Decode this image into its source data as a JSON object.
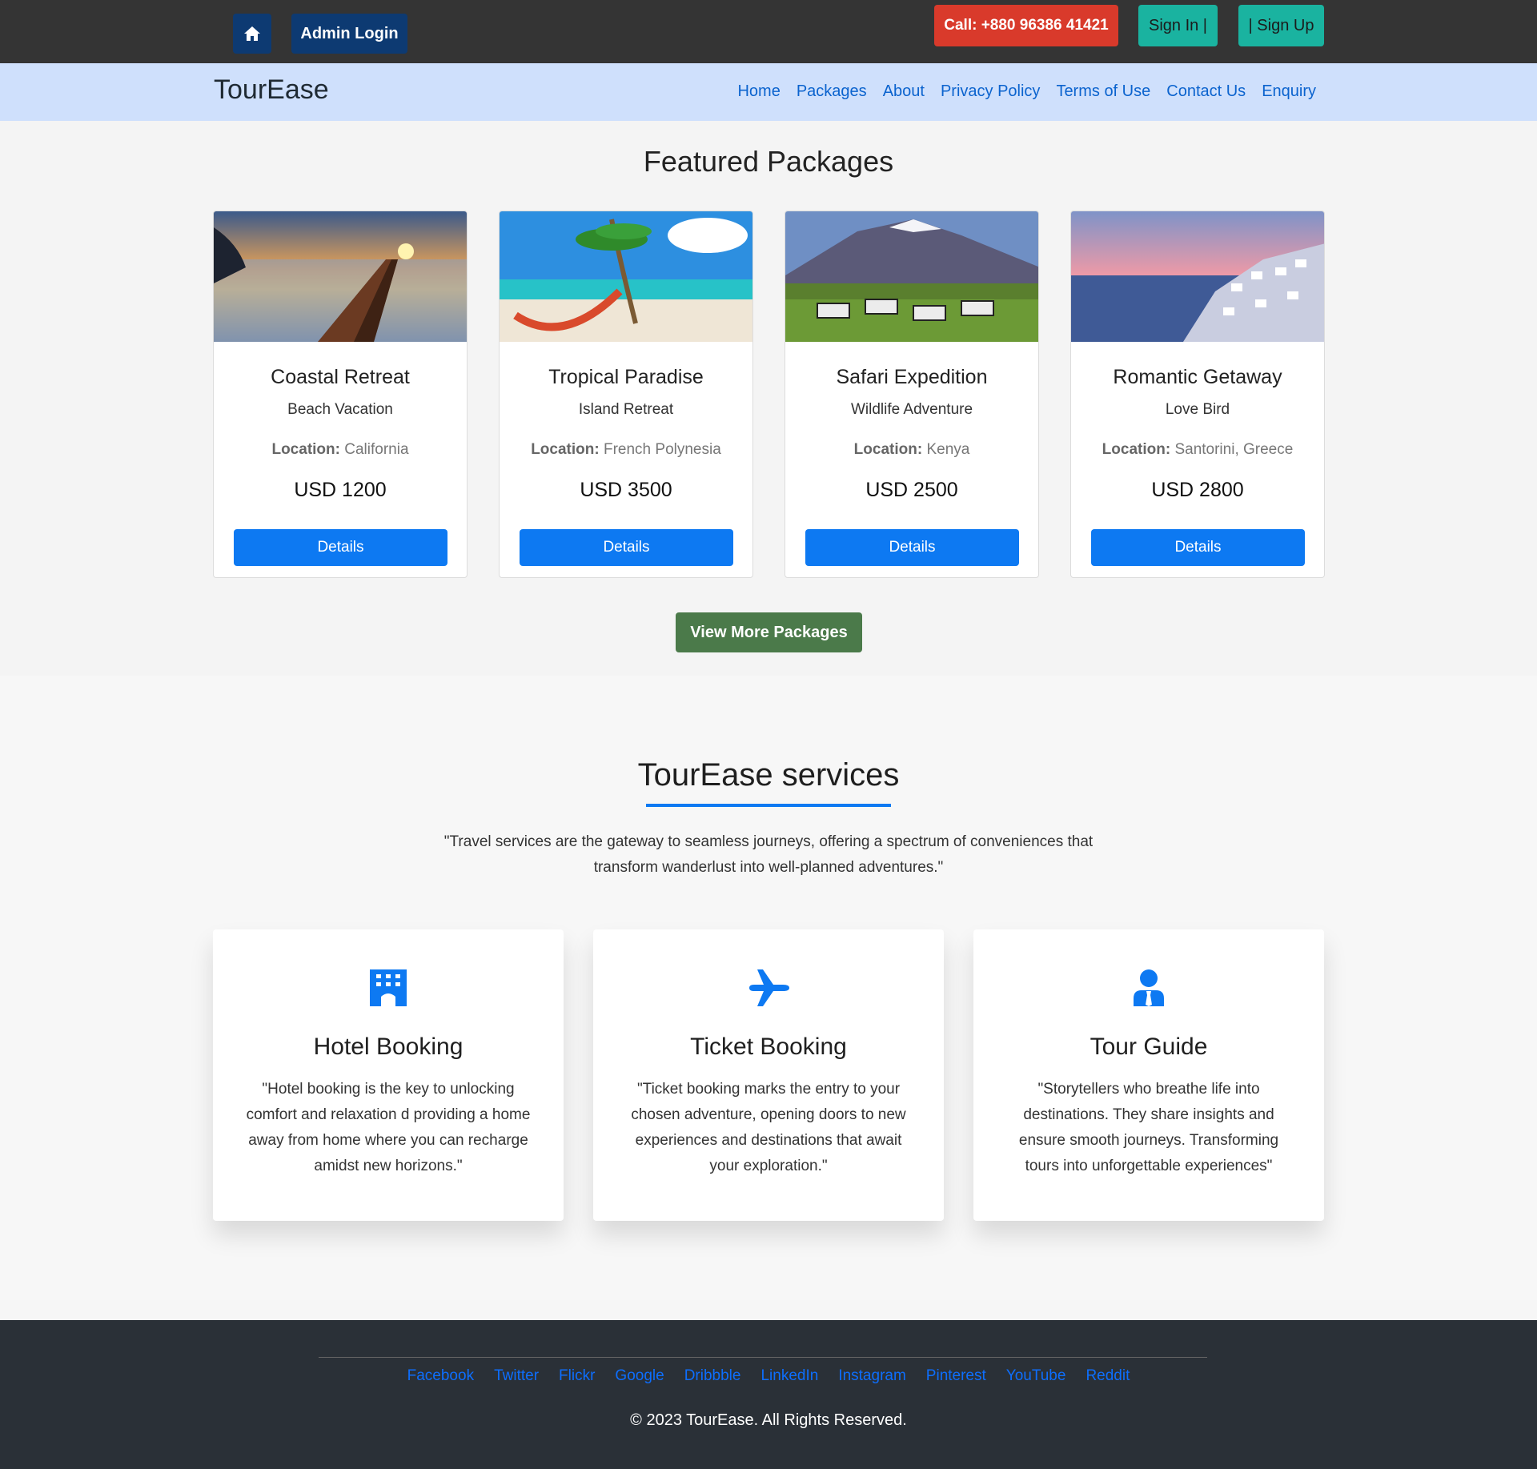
{
  "topbar": {
    "admin_label": "Admin Login",
    "call_label": "Call: +880 96386 41421",
    "signin_label": "Sign In |",
    "signup_label": "| Sign Up",
    "colors": {
      "bg": "#343434",
      "admin": "#0d3a72",
      "call": "#d93a2b",
      "auth": "#1ab3a0"
    }
  },
  "navbar": {
    "brand": "TourEase",
    "links": [
      "Home",
      "Packages",
      "About",
      "Privacy Policy",
      "Terms of Use",
      "Contact Us",
      "Enquiry"
    ]
  },
  "featured": {
    "title": "Featured Packages",
    "packages": [
      {
        "name": "Coastal Retreat",
        "type": "Beach Vacation",
        "location_label": "Location:",
        "location": "California",
        "price": "USD 1200",
        "details_label": "Details"
      },
      {
        "name": "Tropical Paradise",
        "type": "Island Retreat",
        "location_label": "Location:",
        "location": "French Polynesia",
        "price": "USD 3500",
        "details_label": "Details"
      },
      {
        "name": "Safari Expedition",
        "type": "Wildlife Adventure",
        "location_label": "Location:",
        "location": "Kenya",
        "price": "USD 2500",
        "details_label": "Details"
      },
      {
        "name": "Romantic Getaway",
        "type": "Love Bird",
        "location_label": "Location:",
        "location": "Santorini, Greece",
        "price": "USD 2800",
        "details_label": "Details"
      }
    ],
    "more_label": "View More Packages"
  },
  "services": {
    "title": "TourEase services",
    "quote": "\"Travel services are the gateway to seamless journeys, offering a spectrum of conveniences that transform wanderlust into well-planned adventures.\"",
    "items": [
      {
        "icon": "hotel-icon",
        "title": "Hotel Booking",
        "text": "\"Hotel booking is the key to unlocking comfort and relaxation d providing a home away from home where you can recharge amidst new horizons.\""
      },
      {
        "icon": "plane-icon",
        "title": "Ticket Booking",
        "text": "\"Ticket booking marks the entry to your chosen adventure, opening doors to new experiences and destinations that await your exploration.\""
      },
      {
        "icon": "user-tie-icon",
        "title": "Tour Guide",
        "text": "\"Storytellers who breathe life into destinations. They share insights and ensure smooth journeys. Transforming tours into unforgettable experiences\""
      }
    ]
  },
  "footer": {
    "social": [
      "Facebook",
      "Twitter",
      "Flickr",
      "Google",
      "Dribbble",
      "LinkedIn",
      "Instagram",
      "Pinterest",
      "YouTube",
      "Reddit"
    ],
    "copyright": "© 2023 TourEase. All Rights Reserved."
  }
}
